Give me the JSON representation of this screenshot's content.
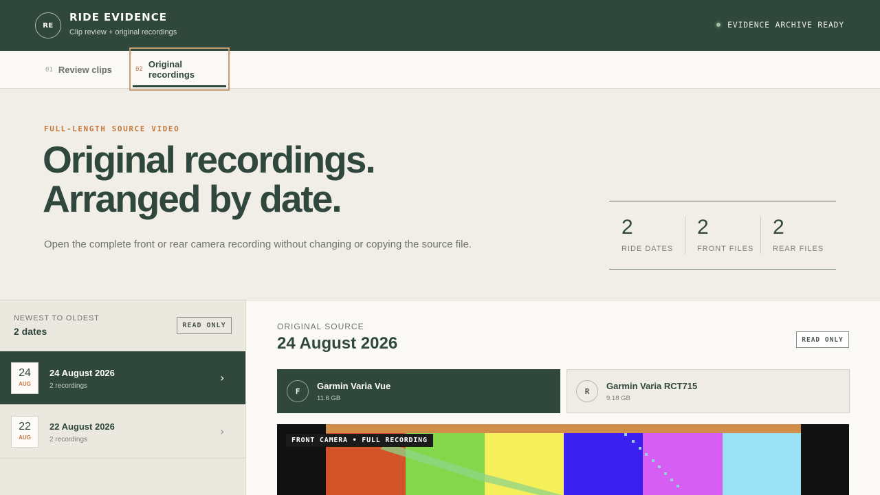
{
  "header": {
    "logo_initials": "RE",
    "title": "RIDE EVIDENCE",
    "subtitle": "Clip review + original recordings",
    "status": "EVIDENCE ARCHIVE READY"
  },
  "tabs": [
    {
      "num": "01",
      "label": "Review clips",
      "active": false
    },
    {
      "num": "02",
      "label": "Original recordings",
      "active": true
    }
  ],
  "hero": {
    "eyebrow": "FULL-LENGTH SOURCE VIDEO",
    "title_line1": "Original recordings.",
    "title_line2": "Arranged by date.",
    "description": "Open the complete front or rear camera recording without changing or copying the source file."
  },
  "stats": [
    {
      "value": "2",
      "label": "RIDE DATES"
    },
    {
      "value": "2",
      "label": "FRONT FILES"
    },
    {
      "value": "2",
      "label": "REAR FILES"
    }
  ],
  "sidebar": {
    "sort_label": "NEWEST TO OLDEST",
    "count_label": "2 dates",
    "badge": "READ ONLY",
    "dates": [
      {
        "day": "24",
        "month": "AUG",
        "title": "24 August 2026",
        "sub": "2 recordings",
        "active": true
      },
      {
        "day": "22",
        "month": "AUG",
        "title": "22 August 2026",
        "sub": "2 recordings",
        "active": false
      }
    ]
  },
  "main": {
    "eyebrow": "ORIGINAL SOURCE",
    "title": "24 August 2026",
    "badge": "READ ONLY",
    "cameras": [
      {
        "initial": "F",
        "name": "Garmin Varia Vue",
        "size": "11.6 GB",
        "selected": true
      },
      {
        "initial": "R",
        "name": "Garmin Varia RCT715",
        "size": "9.18 GB",
        "selected": false
      }
    ],
    "player_label": "FRONT CAMERA • FULL RECORDING"
  },
  "colors": {
    "brand_green": "#30473b",
    "accent_orange": "#c4783f",
    "test_bars": [
      "#d25328",
      "#84d64a",
      "#f5ef5a",
      "#3b21f0",
      "#d65ef2",
      "#9ae1f6"
    ],
    "test_top_bar": "#d18d4a"
  }
}
